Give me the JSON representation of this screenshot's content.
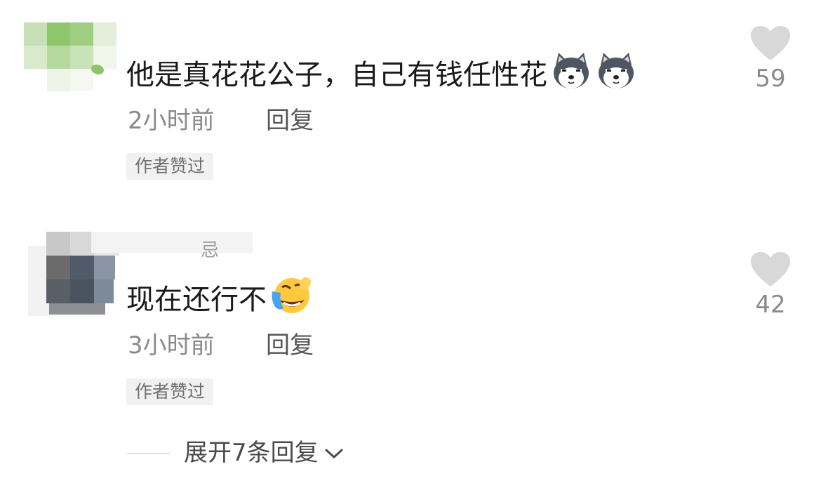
{
  "colors": {
    "text": "#1a1a1a",
    "meta": "#8a8a8a",
    "badge_bg": "#f1f1f1",
    "heart": "#d8d8d8"
  },
  "comments": [
    {
      "text": "他是真花花公子，自己有钱任性花",
      "emojis": [
        "husky-emoji",
        "husky-emoji"
      ],
      "time": "2小时前",
      "reply_label": "回复",
      "badge": "作者赞过",
      "likes": "59",
      "avatar": "blurred-avatar-green"
    },
    {
      "username_fragment": "忌",
      "text": "现在还行不",
      "emojis": [
        "laughing-crying-emoji"
      ],
      "time": "3小时前",
      "reply_label": "回复",
      "badge": "作者赞过",
      "likes": "42",
      "avatar": "blurred-avatar-dark"
    }
  ],
  "expand": {
    "label": "展开7条回复",
    "icon": "chevron-down-icon"
  }
}
